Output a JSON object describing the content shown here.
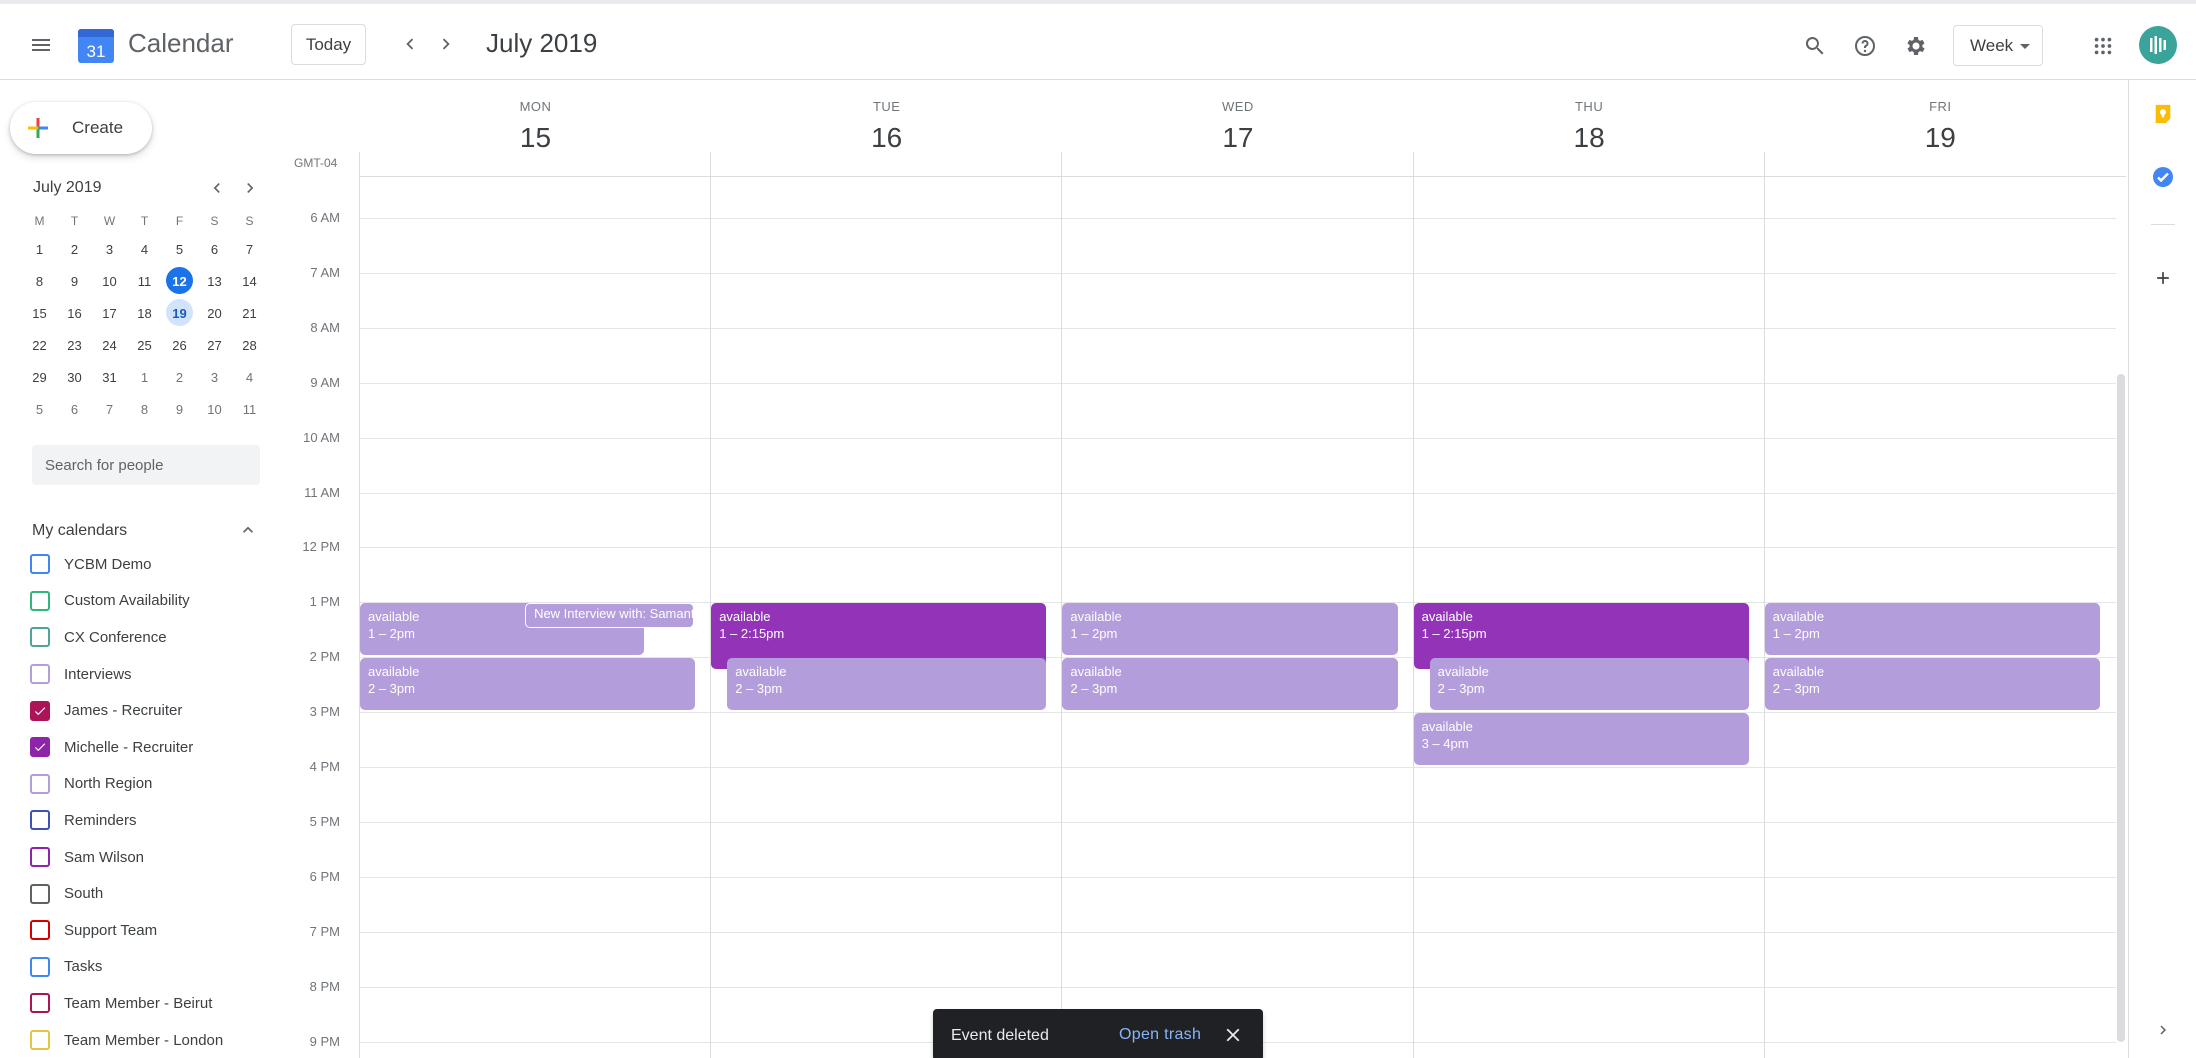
{
  "header": {
    "app_title": "Calendar",
    "logo_day": "31",
    "today_label": "Today",
    "month_title": "July 2019",
    "view_label": "Week"
  },
  "sidebar": {
    "create_label": "Create",
    "mini_cal": {
      "title": "July 2019",
      "weekday_heads": [
        "M",
        "T",
        "W",
        "T",
        "F",
        "S",
        "S"
      ],
      "weeks": [
        [
          "1",
          "2",
          "3",
          "4",
          "5",
          "6",
          "7"
        ],
        [
          "8",
          "9",
          "10",
          "11",
          "12",
          "13",
          "14"
        ],
        [
          "15",
          "16",
          "17",
          "18",
          "19",
          "20",
          "21"
        ],
        [
          "22",
          "23",
          "24",
          "25",
          "26",
          "27",
          "28"
        ],
        [
          "29",
          "30",
          "31",
          "1",
          "2",
          "3",
          "4"
        ],
        [
          "5",
          "6",
          "7",
          "8",
          "9",
          "10",
          "11"
        ]
      ],
      "today": "12",
      "selected": "19"
    },
    "people_search_placeholder": "Search for people",
    "my_calendars_label": "My calendars",
    "calendars": [
      {
        "name": "YCBM Demo",
        "color": "#4285f4",
        "checked": false
      },
      {
        "name": "Custom Availability",
        "color": "#33b679",
        "checked": false
      },
      {
        "name": "CX Conference",
        "color": "#4fa39a",
        "checked": false
      },
      {
        "name": "Interviews",
        "color": "#b39ddb",
        "checked": false
      },
      {
        "name": "James - Recruiter",
        "color": "#ad1457",
        "checked": true
      },
      {
        "name": "Michelle - Recruiter",
        "color": "#8e24aa",
        "checked": true
      },
      {
        "name": "North Region",
        "color": "#b39ddb",
        "checked": false
      },
      {
        "name": "Reminders",
        "color": "#3f51b5",
        "checked": false
      },
      {
        "name": "Sam Wilson",
        "color": "#8e24aa",
        "checked": false
      },
      {
        "name": "South",
        "color": "#616161",
        "checked": false
      },
      {
        "name": "Support Team",
        "color": "#d50000",
        "checked": false
      },
      {
        "name": "Tasks",
        "color": "#4285f4",
        "checked": false
      },
      {
        "name": "Team Member - Beirut",
        "color": "#ad1457",
        "checked": false
      },
      {
        "name": "Team Member - London",
        "color": "#e4c441",
        "checked": false
      }
    ]
  },
  "grid": {
    "timezone": "GMT-04",
    "days": [
      {
        "name": "MON",
        "num": "15"
      },
      {
        "name": "TUE",
        "num": "16"
      },
      {
        "name": "WED",
        "num": "17"
      },
      {
        "name": "THU",
        "num": "18"
      },
      {
        "name": "FRI",
        "num": "19"
      }
    ],
    "hours": [
      "6 AM",
      "7 AM",
      "8 AM",
      "9 AM",
      "10 AM",
      "11 AM",
      "12 PM",
      "1 PM",
      "2 PM",
      "3 PM",
      "4 PM",
      "5 PM",
      "6 PM",
      "7 PM",
      "8 PM",
      "9 PM"
    ],
    "events": [
      {
        "day": 0,
        "title": "available",
        "time": "1 – 2pm",
        "style": "light",
        "start": 13,
        "end": 14,
        "col": "partial-left"
      },
      {
        "day": 0,
        "title": "New Interview with: Samantha",
        "time": "",
        "style": "outlined",
        "start": 13,
        "end": 13.5,
        "col": "partial-right"
      },
      {
        "day": 0,
        "title": "available",
        "time": "2 – 3pm",
        "style": "light",
        "start": 14,
        "end": 15,
        "col": "full"
      },
      {
        "day": 1,
        "title": "available",
        "time": "1 – 2:15pm",
        "style": "dark",
        "start": 13,
        "end": 14.25,
        "col": "full"
      },
      {
        "day": 1,
        "title": "available",
        "time": "2 – 3pm",
        "style": "light",
        "start": 14,
        "end": 15,
        "col": "indent"
      },
      {
        "day": 2,
        "title": "available",
        "time": "1 – 2pm",
        "style": "light",
        "start": 13,
        "end": 14,
        "col": "full"
      },
      {
        "day": 2,
        "title": "available",
        "time": "2 – 3pm",
        "style": "light",
        "start": 14,
        "end": 15,
        "col": "full"
      },
      {
        "day": 3,
        "title": "available",
        "time": "1 – 2:15pm",
        "style": "dark",
        "start": 13,
        "end": 14.25,
        "col": "full"
      },
      {
        "day": 3,
        "title": "available",
        "time": "2 – 3pm",
        "style": "light",
        "start": 14,
        "end": 15,
        "col": "indent"
      },
      {
        "day": 3,
        "title": "available",
        "time": "3 – 4pm",
        "style": "light",
        "start": 15,
        "end": 16,
        "col": "full"
      },
      {
        "day": 4,
        "title": "available",
        "time": "1 – 2pm",
        "style": "light",
        "start": 13,
        "end": 14,
        "col": "full"
      },
      {
        "day": 4,
        "title": "available",
        "time": "2 – 3pm",
        "style": "light",
        "start": 14,
        "end": 15,
        "col": "full"
      }
    ]
  },
  "snackbar": {
    "message": "Event deleted",
    "action": "Open trash"
  },
  "colors": {
    "accent": "#1a73e8",
    "event_light": "#b39ddb",
    "event_dark": "#9334b8"
  }
}
